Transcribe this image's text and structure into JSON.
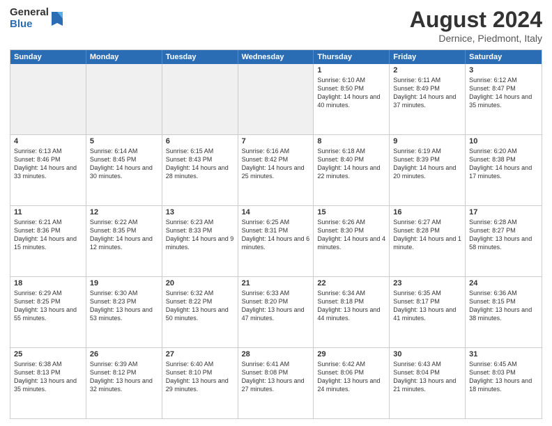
{
  "logo": {
    "general": "General",
    "blue": "Blue"
  },
  "header": {
    "month_year": "August 2024",
    "location": "Dernice, Piedmont, Italy"
  },
  "weekdays": [
    "Sunday",
    "Monday",
    "Tuesday",
    "Wednesday",
    "Thursday",
    "Friday",
    "Saturday"
  ],
  "rows": [
    [
      {
        "day": "",
        "text": ""
      },
      {
        "day": "",
        "text": ""
      },
      {
        "day": "",
        "text": ""
      },
      {
        "day": "",
        "text": ""
      },
      {
        "day": "1",
        "text": "Sunrise: 6:10 AM\nSunset: 8:50 PM\nDaylight: 14 hours and 40 minutes."
      },
      {
        "day": "2",
        "text": "Sunrise: 6:11 AM\nSunset: 8:49 PM\nDaylight: 14 hours and 37 minutes."
      },
      {
        "day": "3",
        "text": "Sunrise: 6:12 AM\nSunset: 8:47 PM\nDaylight: 14 hours and 35 minutes."
      }
    ],
    [
      {
        "day": "4",
        "text": "Sunrise: 6:13 AM\nSunset: 8:46 PM\nDaylight: 14 hours and 33 minutes."
      },
      {
        "day": "5",
        "text": "Sunrise: 6:14 AM\nSunset: 8:45 PM\nDaylight: 14 hours and 30 minutes."
      },
      {
        "day": "6",
        "text": "Sunrise: 6:15 AM\nSunset: 8:43 PM\nDaylight: 14 hours and 28 minutes."
      },
      {
        "day": "7",
        "text": "Sunrise: 6:16 AM\nSunset: 8:42 PM\nDaylight: 14 hours and 25 minutes."
      },
      {
        "day": "8",
        "text": "Sunrise: 6:18 AM\nSunset: 8:40 PM\nDaylight: 14 hours and 22 minutes."
      },
      {
        "day": "9",
        "text": "Sunrise: 6:19 AM\nSunset: 8:39 PM\nDaylight: 14 hours and 20 minutes."
      },
      {
        "day": "10",
        "text": "Sunrise: 6:20 AM\nSunset: 8:38 PM\nDaylight: 14 hours and 17 minutes."
      }
    ],
    [
      {
        "day": "11",
        "text": "Sunrise: 6:21 AM\nSunset: 8:36 PM\nDaylight: 14 hours and 15 minutes."
      },
      {
        "day": "12",
        "text": "Sunrise: 6:22 AM\nSunset: 8:35 PM\nDaylight: 14 hours and 12 minutes."
      },
      {
        "day": "13",
        "text": "Sunrise: 6:23 AM\nSunset: 8:33 PM\nDaylight: 14 hours and 9 minutes."
      },
      {
        "day": "14",
        "text": "Sunrise: 6:25 AM\nSunset: 8:31 PM\nDaylight: 14 hours and 6 minutes."
      },
      {
        "day": "15",
        "text": "Sunrise: 6:26 AM\nSunset: 8:30 PM\nDaylight: 14 hours and 4 minutes."
      },
      {
        "day": "16",
        "text": "Sunrise: 6:27 AM\nSunset: 8:28 PM\nDaylight: 14 hours and 1 minute."
      },
      {
        "day": "17",
        "text": "Sunrise: 6:28 AM\nSunset: 8:27 PM\nDaylight: 13 hours and 58 minutes."
      }
    ],
    [
      {
        "day": "18",
        "text": "Sunrise: 6:29 AM\nSunset: 8:25 PM\nDaylight: 13 hours and 55 minutes."
      },
      {
        "day": "19",
        "text": "Sunrise: 6:30 AM\nSunset: 8:23 PM\nDaylight: 13 hours and 53 minutes."
      },
      {
        "day": "20",
        "text": "Sunrise: 6:32 AM\nSunset: 8:22 PM\nDaylight: 13 hours and 50 minutes."
      },
      {
        "day": "21",
        "text": "Sunrise: 6:33 AM\nSunset: 8:20 PM\nDaylight: 13 hours and 47 minutes."
      },
      {
        "day": "22",
        "text": "Sunrise: 6:34 AM\nSunset: 8:18 PM\nDaylight: 13 hours and 44 minutes."
      },
      {
        "day": "23",
        "text": "Sunrise: 6:35 AM\nSunset: 8:17 PM\nDaylight: 13 hours and 41 minutes."
      },
      {
        "day": "24",
        "text": "Sunrise: 6:36 AM\nSunset: 8:15 PM\nDaylight: 13 hours and 38 minutes."
      }
    ],
    [
      {
        "day": "25",
        "text": "Sunrise: 6:38 AM\nSunset: 8:13 PM\nDaylight: 13 hours and 35 minutes."
      },
      {
        "day": "26",
        "text": "Sunrise: 6:39 AM\nSunset: 8:12 PM\nDaylight: 13 hours and 32 minutes."
      },
      {
        "day": "27",
        "text": "Sunrise: 6:40 AM\nSunset: 8:10 PM\nDaylight: 13 hours and 29 minutes."
      },
      {
        "day": "28",
        "text": "Sunrise: 6:41 AM\nSunset: 8:08 PM\nDaylight: 13 hours and 27 minutes."
      },
      {
        "day": "29",
        "text": "Sunrise: 6:42 AM\nSunset: 8:06 PM\nDaylight: 13 hours and 24 minutes."
      },
      {
        "day": "30",
        "text": "Sunrise: 6:43 AM\nSunset: 8:04 PM\nDaylight: 13 hours and 21 minutes."
      },
      {
        "day": "31",
        "text": "Sunrise: 6:45 AM\nSunset: 8:03 PM\nDaylight: 13 hours and 18 minutes."
      }
    ]
  ]
}
